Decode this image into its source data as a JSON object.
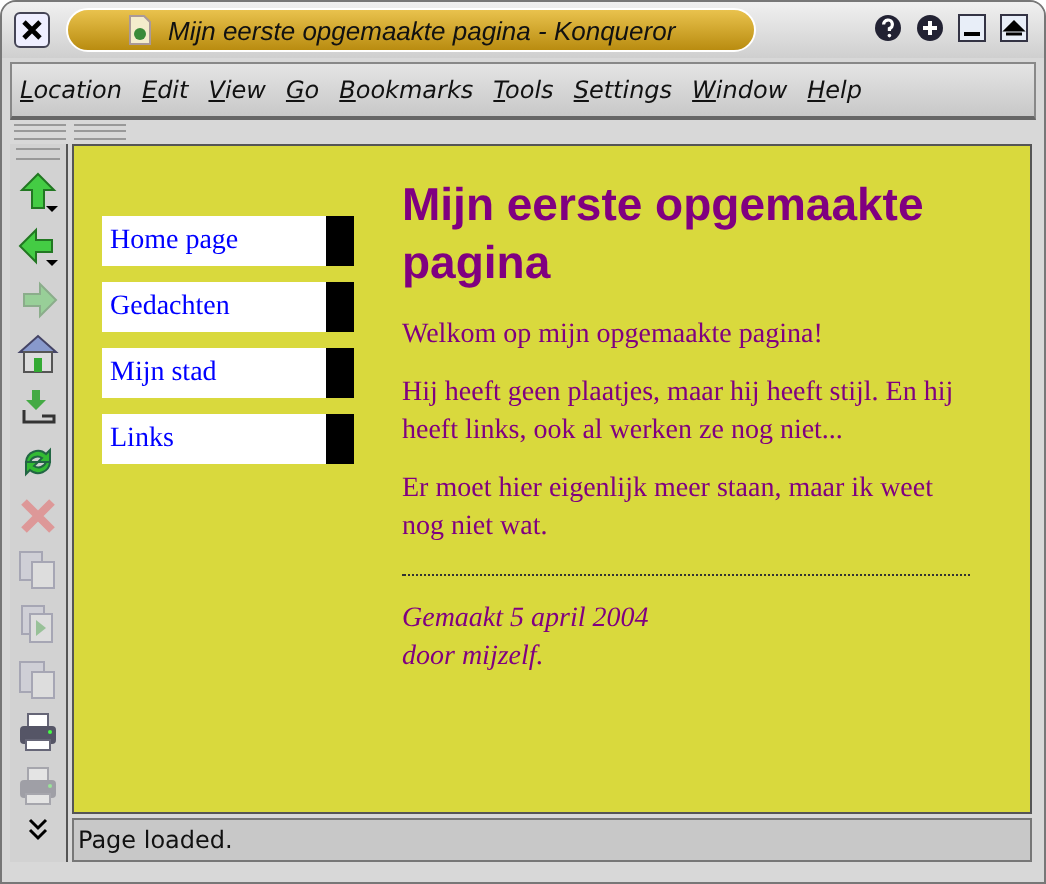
{
  "window": {
    "title": "Mijn eerste opgemaakte pagina - Konqueror"
  },
  "menu": [
    "Location",
    "Edit",
    "View",
    "Go",
    "Bookmarks",
    "Tools",
    "Settings",
    "Window",
    "Help"
  ],
  "toolbar": [
    {
      "kind": "up",
      "disabled": false
    },
    {
      "kind": "back",
      "disabled": false
    },
    {
      "kind": "forward",
      "disabled": true
    },
    {
      "kind": "home",
      "disabled": false
    },
    {
      "kind": "download",
      "disabled": false
    },
    {
      "kind": "reload",
      "disabled": false
    },
    {
      "kind": "stop",
      "disabled": true
    },
    {
      "kind": "copy",
      "disabled": true
    },
    {
      "kind": "play",
      "disabled": true
    },
    {
      "kind": "paste",
      "disabled": true
    },
    {
      "kind": "print",
      "disabled": false
    },
    {
      "kind": "print",
      "disabled": true
    }
  ],
  "nav": [
    "Home page",
    "Gedachten",
    "Mijn stad",
    "Links"
  ],
  "heading": "Mijn eerste opgemaakte pagina",
  "paragraphs": [
    "Welkom op mijn opgemaakte pagina!",
    "Hij heeft geen plaatjes, maar hij heeft stijl. En hij heeft links, ook al werken ze nog niet...",
    "Er moet hier eigenlijk meer staan, maar ik weet nog niet wat."
  ],
  "footer": [
    "Gemaakt 5 april 2004",
    "door mijzelf."
  ],
  "status_bar": "Page loaded."
}
